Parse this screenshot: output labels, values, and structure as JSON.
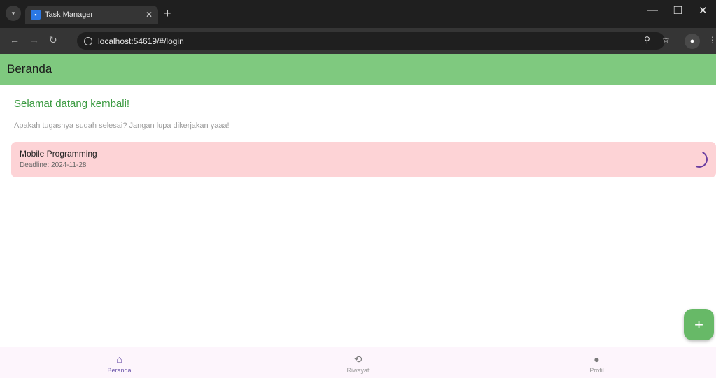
{
  "browser": {
    "tab_title": "Task Manager",
    "url": "localhost:54619/#/login"
  },
  "app": {
    "title": "Beranda",
    "welcome": "Selamat datang kembali!",
    "subtitle": "Apakah tugasnya sudah selesai? Jangan lupa dikerjakan yaaa!"
  },
  "tasks": [
    {
      "title": "Mobile Programming",
      "deadline": "Deadline: 2024-11-28"
    }
  ],
  "fab": {
    "label": "+"
  },
  "bottom_nav": [
    {
      "label": "Beranda",
      "icon": "home-icon",
      "active": true
    },
    {
      "label": "Riwayat",
      "icon": "history-icon",
      "active": false
    },
    {
      "label": "Profil",
      "icon": "person-icon",
      "active": false
    }
  ],
  "colors": {
    "appbar": "#7fc97f",
    "task_card": "#fdd3d6",
    "fab": "#67b967",
    "accent": "#5a3fa0"
  }
}
